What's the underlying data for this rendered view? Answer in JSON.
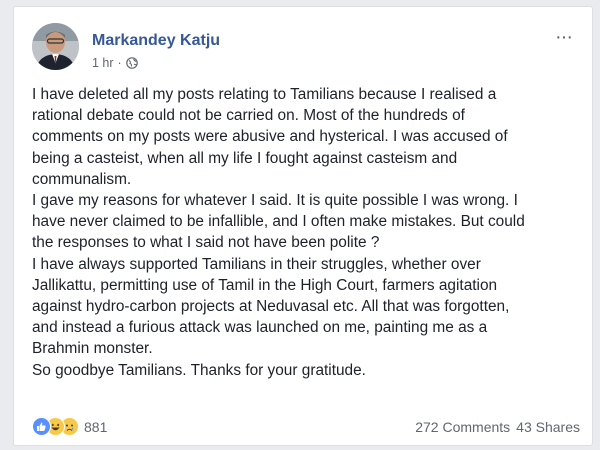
{
  "post": {
    "author": "Markandey Katju",
    "timestamp": "1 hr",
    "separator": "·",
    "privacy_icon": "globe-icon",
    "more_label": "···",
    "body": "I have deleted all my posts relating to Tamilians because I realised a\nrational debate could not be carried on. Most of the hundreds of\ncomments on my posts were abusive and hysterical. I was accused of\nbeing a casteist, when all my life I fought against casteism and\ncommunalism.\nI gave my reasons for whatever I said. It is quite possible I was wrong. I\nhave never claimed to be infallible, and I often make mistakes. But could\nthe responses to what I said not have been polite ?\nI have always supported Tamilians in their struggles, whether over\nJallikattu, permitting use of Tamil in the High Court, farmers agitation\nagainst hydro-carbon projects at Neduvasal etc. All that was forgotten,\nand instead a furious attack was launched on me, painting me as a\nBrahmin monster.\nSo goodbye Tamilians. Thanks for your gratitude.",
    "reactions": {
      "icons": [
        "like-icon",
        "haha-icon",
        "sad-icon"
      ],
      "count": "881"
    },
    "comments": "272 Comments",
    "shares": "43 Shares"
  },
  "colors": {
    "author_link": "#365899",
    "text": "#1d2129",
    "muted": "#606770",
    "like_blue": "#5890ff",
    "emoji_yellow": "#f7c94a"
  }
}
